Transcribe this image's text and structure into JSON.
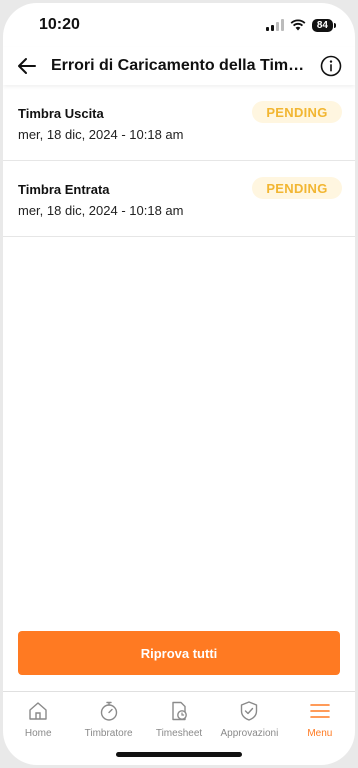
{
  "status": {
    "time": "10:20",
    "battery": "84"
  },
  "header": {
    "title": "Errori di Caricamento della Timbrature"
  },
  "items": [
    {
      "title": "Timbra Uscita",
      "date": "mer, 18 dic, 2024 - 10:18 am",
      "status": "PENDING"
    },
    {
      "title": "Timbra Entrata",
      "date": "mer, 18 dic, 2024 - 10:18 am",
      "status": "PENDING"
    }
  ],
  "retry_label": "Riprova tutti",
  "tabs": [
    {
      "label": "Home",
      "icon": "home-icon"
    },
    {
      "label": "Timbratore",
      "icon": "stopwatch-icon"
    },
    {
      "label": "Timesheet",
      "icon": "timesheet-icon"
    },
    {
      "label": "Approvazioni",
      "icon": "shield-check-icon"
    },
    {
      "label": "Menu",
      "icon": "menu-icon"
    }
  ],
  "colors": {
    "accent": "#ff7a22",
    "badge_bg": "#fff6e0",
    "badge_text": "#f2b632"
  }
}
